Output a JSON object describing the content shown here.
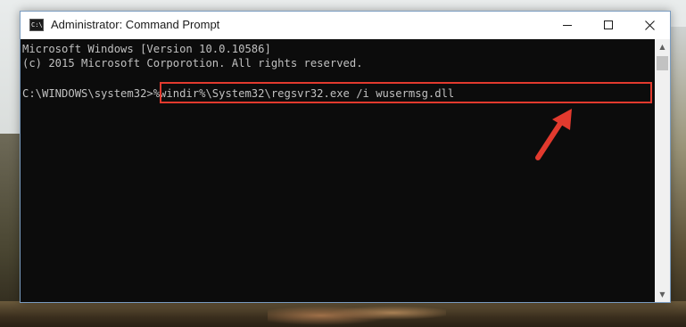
{
  "window": {
    "title": "Administrator: Command Prompt",
    "icon": "console-icon",
    "icon_text": "C:\\",
    "controls": {
      "minimize_icon": "minimize-icon",
      "maximize_icon": "maximize-icon",
      "close_icon": "close-icon"
    }
  },
  "console": {
    "lines": [
      "Microsoft Windows [Version 10.0.10586]",
      "(c) 2015 Microsoft Corporotion. All rights reserved.",
      ""
    ],
    "prompt": "C:\\WINDOWS\\system32>",
    "command": "%windir%\\System32\\regsvr32.exe /i wusermsg.dll"
  },
  "annotation": {
    "highlight_color": "#e23a2e",
    "arrow_color": "#e23a2e"
  },
  "scrollbar": {
    "up_icon": "scroll-up-arrow-icon",
    "down_icon": "scroll-down-arrow-icon",
    "up_glyph": "▲",
    "down_glyph": "▼"
  }
}
